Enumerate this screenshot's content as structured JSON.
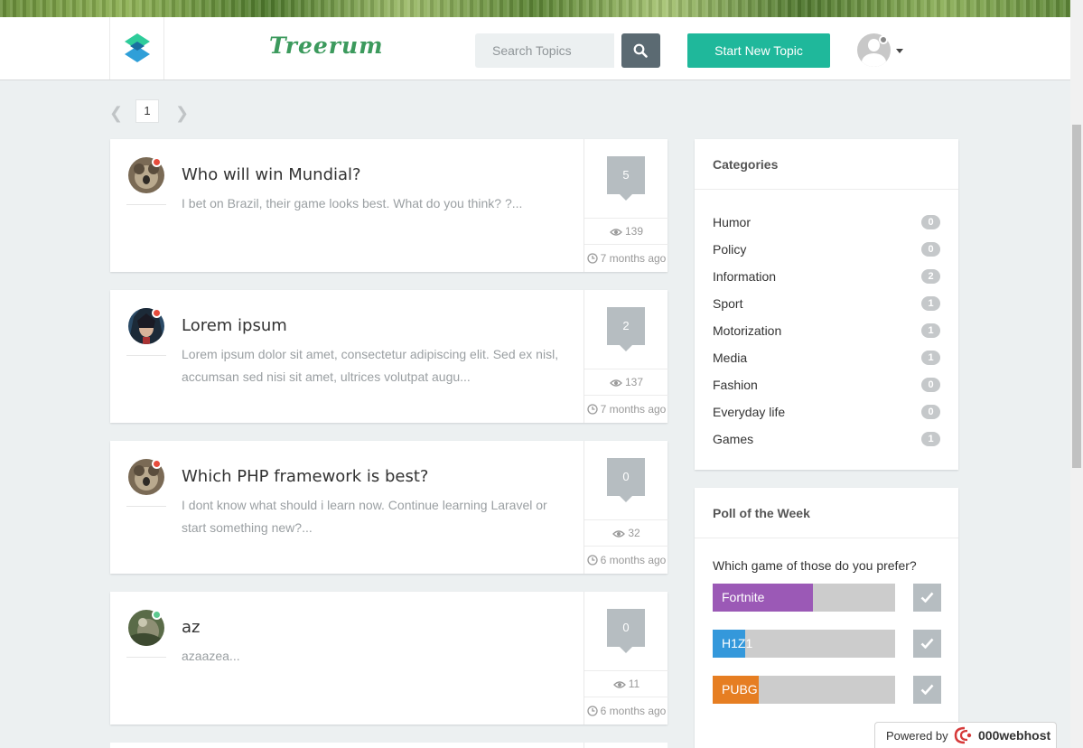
{
  "header": {
    "brand": "Treerum",
    "search": {
      "placeholder": "Search Topics"
    },
    "new_topic_label": "Start New Topic"
  },
  "pagination": {
    "current_page": "1"
  },
  "topics": [
    {
      "title": "Who will win Mundial?",
      "excerpt": "I bet on Brazil, their game looks best. What do you think? ?...",
      "replies": "5",
      "views": "139",
      "time": "7 months ago",
      "status": "offline"
    },
    {
      "title": "Lorem ipsum",
      "excerpt": "Lorem ipsum dolor sit amet, consectetur adipiscing elit. Sed ex nisl, accumsan sed nisi sit amet, ultrices volutpat augu...",
      "replies": "2",
      "views": "137",
      "time": "7 months ago",
      "status": "offline"
    },
    {
      "title": "Which PHP framework is best?",
      "excerpt": "I dont know what should i learn now. Continue learning Laravel or start something new?...",
      "replies": "0",
      "views": "32",
      "time": "6 months ago",
      "status": "offline"
    },
    {
      "title": "az",
      "excerpt": "azaazea...",
      "replies": "0",
      "views": "11",
      "time": "6 months ago",
      "status": "online"
    }
  ],
  "categories": {
    "title": "Categories",
    "items": [
      {
        "name": "Humor",
        "count": "0"
      },
      {
        "name": "Policy",
        "count": "0"
      },
      {
        "name": "Information",
        "count": "2"
      },
      {
        "name": "Sport",
        "count": "1"
      },
      {
        "name": "Motorization",
        "count": "1"
      },
      {
        "name": "Media",
        "count": "1"
      },
      {
        "name": "Fashion",
        "count": "0"
      },
      {
        "name": "Everyday life",
        "count": "0"
      },
      {
        "name": "Games",
        "count": "1"
      }
    ]
  },
  "poll": {
    "title": "Poll of the Week",
    "question": "Which game of those do you prefer?",
    "options": [
      {
        "label": "Fortnite",
        "share": 0.55,
        "color": "#9b59b6"
      },
      {
        "label": "H1Z1",
        "share": 0.18,
        "color": "#3498db"
      },
      {
        "label": "PUBG",
        "share": 0.25,
        "color": "#e67e22"
      }
    ]
  },
  "footer_badge": {
    "powered_by": "Powered by",
    "host": "000webhost"
  },
  "colors": {
    "accent": "#1fb89b",
    "brand": "#3c9a5d",
    "status_offline": "#e74c3c",
    "status_online": "#5cc98f"
  }
}
